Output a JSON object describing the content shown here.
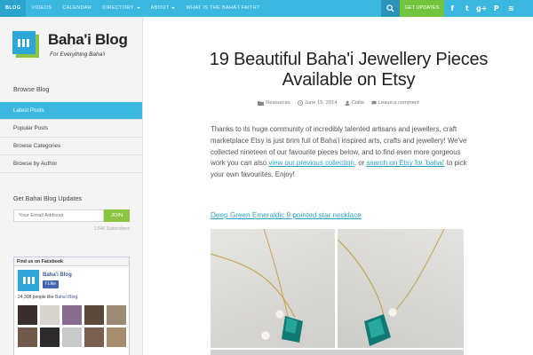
{
  "topnav": {
    "items": [
      {
        "label": "BLOG",
        "active": true
      },
      {
        "label": "VIDEOS"
      },
      {
        "label": "CALENDAR"
      },
      {
        "label": "DIRECTORY",
        "caret": true
      },
      {
        "label": "ABOUT",
        "caret": true
      },
      {
        "label": "WHAT IS THE BAHÁ'Í FAITH?"
      }
    ],
    "search_icon": "search-icon",
    "get_updates": "GET UPDATES",
    "social": [
      {
        "name": "facebook-icon",
        "glyph": "f"
      },
      {
        "name": "twitter-icon",
        "glyph": "t"
      },
      {
        "name": "google-plus-icon",
        "glyph": "g+"
      },
      {
        "name": "pinterest-icon",
        "glyph": "P"
      },
      {
        "name": "rss-icon",
        "glyph": "≋"
      }
    ],
    "colors": {
      "bar": "#3bb8e0",
      "accent": "#71c43b"
    }
  },
  "sidebar": {
    "logo_title": "Baha'i Blog",
    "logo_tagline": "For Everything Baha'i",
    "browse_heading": "Browse Blog",
    "menu": [
      "Latest Posts",
      "Popular Posts",
      "Browse Categories",
      "Browse by Author"
    ],
    "active_menu": 0,
    "updates_heading": "Get Bahai Blog Updates",
    "email_placeholder": "Your Email Address",
    "join_label": "JOIN",
    "subscribers": "1,546 Subscribers",
    "facebook": {
      "heading": "Find us on Facebook",
      "page_name": "Baha'i Blog",
      "like_label": "Like",
      "count_text": "24,308 people like ",
      "count_link": "Baha'i Blog."
    }
  },
  "post": {
    "title": "19 Beautiful Baha'i Jewellery Pieces Available on Etsy",
    "meta": {
      "category": "Resources",
      "date": "June 15, 2014",
      "author": "Collis",
      "comment": "Leave a comment"
    },
    "body_1": "Thanks to its huge community of incredibly talented artisans and jewellers, craft marketplace Etsy is just brim full of Baha'i inspired arts, crafts and jewellery! We've collected nineteen of our favourite pieces below, and to find even more gorgeous work you can also ",
    "link_1": "view our previous collection",
    "body_2": ", or ",
    "link_2": "search on Etsy for 'bahai'",
    "body_3": " to pick your own favourites. Enjoy!",
    "item_link": "Deep Green Emeraldic 9 pointed star necklace"
  }
}
